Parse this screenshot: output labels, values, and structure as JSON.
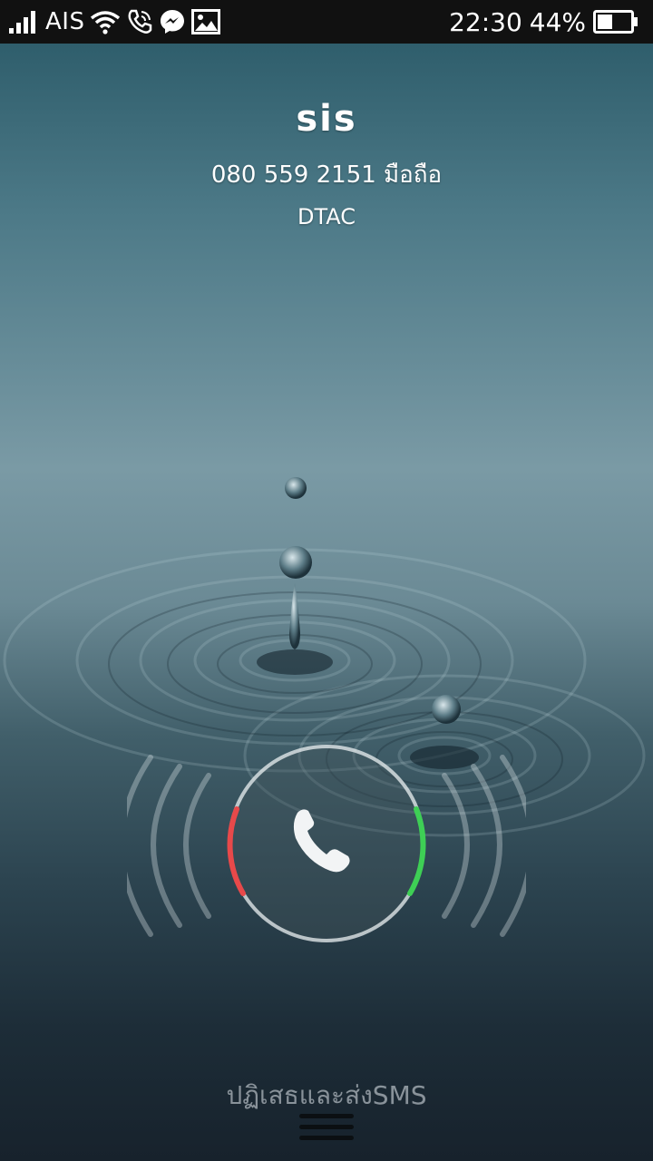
{
  "status_bar": {
    "carrier": "AIS",
    "time": "22:30",
    "battery_percent": "44%",
    "battery_level": 0.44,
    "icons": [
      "signal-icon",
      "wifi-icon",
      "call-icon",
      "messenger-icon",
      "gallery-icon",
      "battery-icon"
    ]
  },
  "caller": {
    "name": "sis",
    "number": "080 559 2151 มือถือ",
    "carrier": "DTAC"
  },
  "answer_control": {
    "icon": "phone-icon",
    "decline_color": "#e8494a",
    "accept_color": "#3ecf55"
  },
  "bottom": {
    "reject_sms_label": "ปฏิเสธและส่งSMS"
  }
}
